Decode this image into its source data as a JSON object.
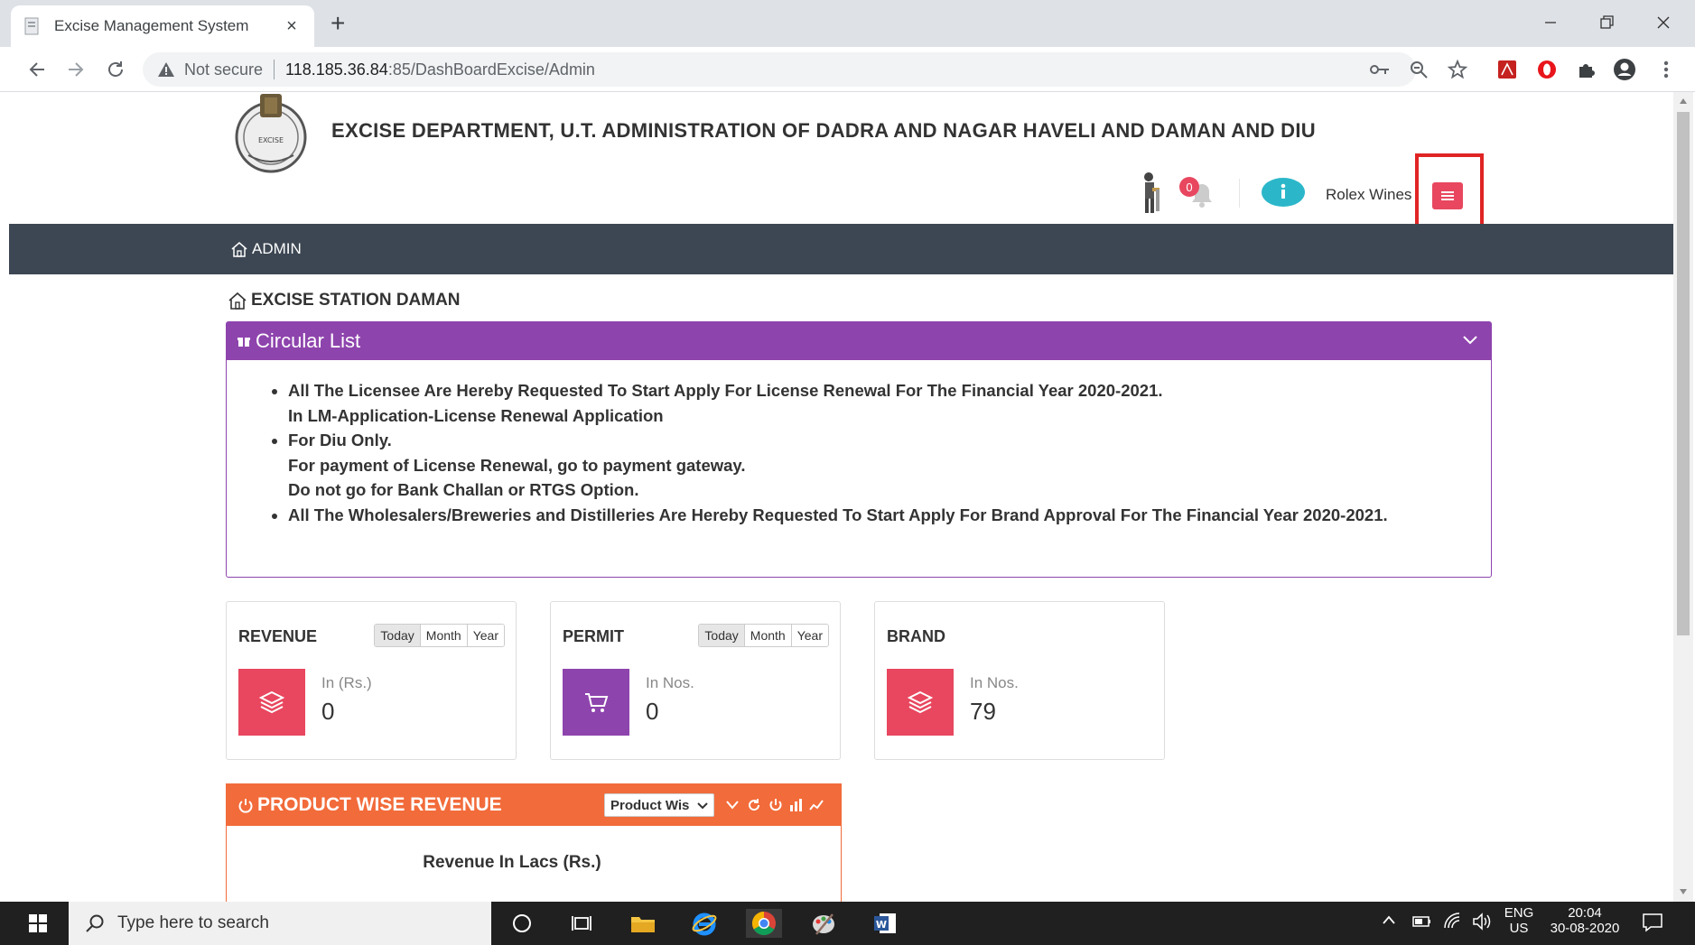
{
  "browser": {
    "tab_title": "Excise Management System",
    "tab_close": "×",
    "new_tab": "+",
    "security_label": "Not secure",
    "url_host": "118.185.36.84",
    "url_path": ":85/DashBoardExcise/Admin"
  },
  "header": {
    "department_title": "EXCISE DEPARTMENT, U.T. ADMINISTRATION OF DADRA AND NAGAR HAVELI AND DAMAN AND DIU",
    "logo_text": "EXCISE",
    "notification_count": "0",
    "user_name": "Rolex Wines"
  },
  "nav": {
    "admin_label": "ADMIN"
  },
  "station": {
    "label": "EXCISE STATION DAMAN"
  },
  "circular": {
    "title": "Circular List",
    "items": [
      {
        "lines": [
          "All The Licensee Are Hereby Requested To Start Apply For License Renewal For The Financial Year 2020-2021.",
          "In LM-Application-License Renewal Application"
        ]
      },
      {
        "lines": [
          "For Diu Only.",
          "For payment of License Renewal, go to payment gateway.",
          "Do not go for Bank Challan or RTGS Option."
        ]
      },
      {
        "lines": [
          "All The Wholesalers/Breweries and Distilleries Are Hereby Requested To Start Apply For Brand Approval For The Financial Year 2020-2021."
        ]
      }
    ]
  },
  "cards": {
    "revenue": {
      "title": "REVENUE",
      "unit": "In (Rs.)",
      "value": "0",
      "periods": [
        "Today",
        "Month",
        "Year"
      ],
      "color": "#e8475f"
    },
    "permit": {
      "title": "PERMIT",
      "unit": "In Nos.",
      "value": "0",
      "periods": [
        "Today",
        "Month",
        "Year"
      ],
      "color": "#8e44ad"
    },
    "brand": {
      "title": "BRAND",
      "unit": "In Nos.",
      "value": "79",
      "color": "#e8475f"
    }
  },
  "product_revenue": {
    "title": "PRODUCT WISE REVENUE",
    "select_value": "Product Wis",
    "subtitle": "Revenue In Lacs (Rs.)",
    "color": "#f26b3a"
  },
  "taskbar": {
    "search_placeholder": "Type here to search",
    "lang": "ENG",
    "region": "US",
    "time": "20:04",
    "date": "30-08-2020"
  },
  "colors": {
    "nav_bg": "#3d4753",
    "circular_header": "#8e44ad",
    "highlight_box": "#e02424"
  }
}
